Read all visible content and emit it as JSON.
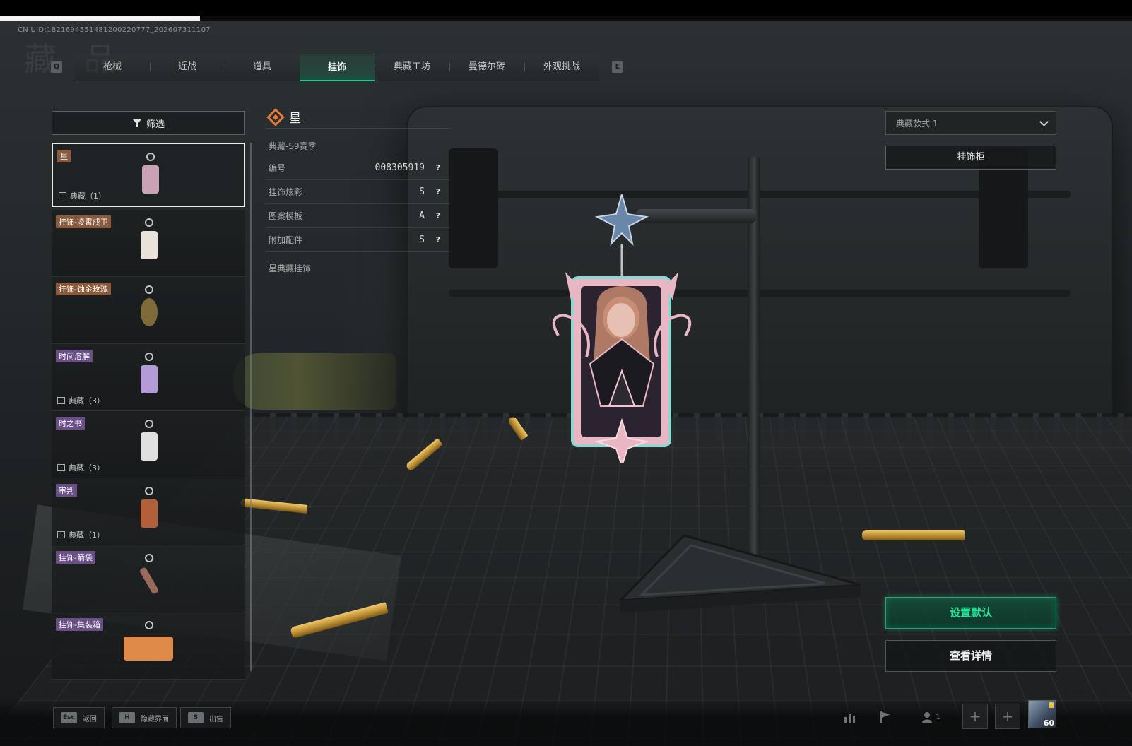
{
  "uid_text": "CN UID:1821694551481200220777_202607311107",
  "ghost_title": "藏 品",
  "tabs": {
    "prev_key": "Q",
    "next_key": "E",
    "items": [
      {
        "label": "枪械",
        "active": false
      },
      {
        "label": "近战",
        "active": false
      },
      {
        "label": "道具",
        "active": false
      },
      {
        "label": "挂饰",
        "active": true
      },
      {
        "label": "典藏工坊",
        "active": false
      },
      {
        "label": "曼德尔砖",
        "active": false
      },
      {
        "label": "外观挑战",
        "active": false
      }
    ]
  },
  "filter": {
    "label": "筛选"
  },
  "list": [
    {
      "tag": "星",
      "tag_color": "gold",
      "collection": "典藏（1）",
      "selected": true,
      "charm_color": "#c9a3b4"
    },
    {
      "tag": "挂饰-凌霄戍卫",
      "tag_color": "gold",
      "collection": "",
      "selected": false,
      "charm_color": "#e9e2d8"
    },
    {
      "tag": "挂饰-蚀金玫瑰",
      "tag_color": "gold",
      "collection": "",
      "selected": false,
      "charm_color": "#7f6a3a"
    },
    {
      "tag": "时间溶解",
      "tag_color": "purple",
      "collection": "典藏（3）",
      "selected": false,
      "charm_color": "#b49ad6"
    },
    {
      "tag": "时之书",
      "tag_color": "purple",
      "collection": "典藏（3）",
      "selected": false,
      "charm_color": "#e0e0e0"
    },
    {
      "tag": "审判",
      "tag_color": "purple",
      "collection": "典藏（1）",
      "selected": false,
      "charm_color": "#b35f3a"
    },
    {
      "tag": "挂饰-箭袋",
      "tag_color": "purple",
      "collection": "",
      "selected": false,
      "charm_color": "#9a6a5a"
    },
    {
      "tag": "挂饰-集装箱",
      "tag_color": "purple",
      "collection": "",
      "selected": false,
      "charm_color": "#e08a4a"
    }
  ],
  "detail": {
    "title": "星",
    "season": "典藏-S9赛季",
    "rows": [
      {
        "label": "编号",
        "value": "008305919"
      },
      {
        "label": "挂饰炫彩",
        "value": "S"
      },
      {
        "label": "图案模板",
        "value": "A"
      },
      {
        "label": "附加配件",
        "value": "S"
      }
    ],
    "help_glyph": "?",
    "footnote": "星典藏挂饰"
  },
  "right": {
    "style_select": "典藏款式 1",
    "cabinet_button": "挂饰柜",
    "set_default_button": "设置默认",
    "view_details_button": "查看详情"
  },
  "bottom": {
    "hints": [
      {
        "key": "Esc",
        "label": "返回"
      },
      {
        "key": "H",
        "label": "隐藏界面"
      },
      {
        "key": "S",
        "label": "出售"
      }
    ],
    "friends_count": "1",
    "level": "60"
  },
  "colors": {
    "accent_green": "#20c98a",
    "tag_gold": "#8a5a3a",
    "tag_purple": "#6a4f86",
    "title_icon": "#e8793a"
  },
  "icons": [
    "filter-icon",
    "collection-icon",
    "chevron-down-icon",
    "help-icon",
    "stats-icon",
    "flag-icon",
    "friends-icon",
    "plus-icon",
    "title-diamond-icon"
  ]
}
